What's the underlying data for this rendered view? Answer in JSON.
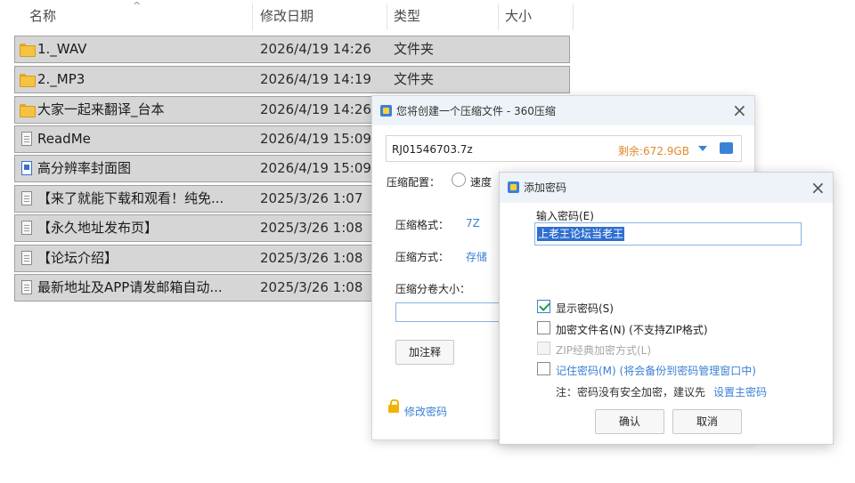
{
  "explorer": {
    "headers": {
      "name": "名称",
      "modified": "修改日期",
      "type": "类型",
      "size": "大小"
    },
    "sort_arrow": "^",
    "rows": [
      {
        "name": "1._WAV",
        "date": "2026/4/19 14:26",
        "type": "文件夹",
        "icon": "folder-icon"
      },
      {
        "name": "2._MP3",
        "date": "2026/4/19 14:19",
        "type": "文件夹",
        "icon": "folder-icon"
      },
      {
        "name": "大家一起来翻译_台本",
        "date": "2026/4/19 14:26",
        "type": "",
        "icon": "folder-icon"
      },
      {
        "name": "ReadMe",
        "date": "2026/4/19 15:09",
        "type": "",
        "icon": "document-icon"
      },
      {
        "name": "高分辨率封面图",
        "date": "2026/4/19 15:09",
        "type": "",
        "icon": "image-icon"
      },
      {
        "name": "【来了就能下载和观看！纯免...",
        "date": "2025/3/26 1:07",
        "type": "",
        "icon": "document-icon"
      },
      {
        "name": "【永久地址发布页】",
        "date": "2025/3/26 1:08",
        "type": "",
        "icon": "document-icon"
      },
      {
        "name": "【论坛介绍】",
        "date": "2025/3/26 1:08",
        "type": "",
        "icon": "document-icon"
      },
      {
        "name": "最新地址及APP请发邮箱自动...",
        "date": "2025/3/26 1:08",
        "type": "",
        "icon": "document-icon"
      }
    ]
  },
  "compress_dialog": {
    "title": "您将创建一个压缩文件 - 360压缩",
    "close": "×",
    "filename": "RJ01546703.7z",
    "free_space": "剩余:672.9GB",
    "config_label": "压缩配置：",
    "speed_option": "速度",
    "format_label": "压缩格式：",
    "format_value": "7Z",
    "method_label": "压缩方式：",
    "method_value": "存储",
    "split_label": "压缩分卷大小：",
    "comment_button": "加注释",
    "change_password": "修改密码"
  },
  "password_dialog": {
    "title": "添加密码",
    "close": "×",
    "input_label": "输入密码(E)",
    "password_value": "上老王论坛当老王",
    "options": {
      "show_password": {
        "label": "显示密码(S)",
        "checked": true
      },
      "encrypt_filenames": {
        "label": "加密文件名(N) (不支持ZIP格式)",
        "checked": false
      },
      "zip_legacy": {
        "label": "ZIP经典加密方式(L)",
        "checked": false,
        "disabled": true
      },
      "remember_password": {
        "label": "记住密码(M) (将会备份到密码管理窗口中)",
        "checked": false
      }
    },
    "note_prefix": "注：密码没有安全加密，建议先",
    "note_link": "设置主密码",
    "ok_button": "确认",
    "cancel_button": "取消"
  },
  "colors": {
    "accent": "#3b7fd4",
    "free_space": "#e08a2a",
    "selection": "#2f6fd0",
    "row_highlight": "#d6d6d6"
  }
}
